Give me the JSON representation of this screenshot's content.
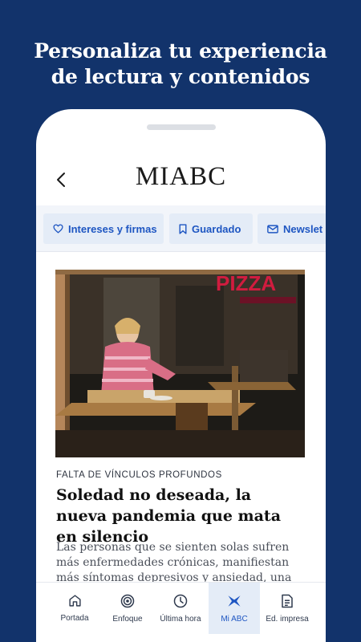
{
  "promo": {
    "title_line1": "Personaliza tu experiencia",
    "title_line2": "de lectura y contenidos"
  },
  "header": {
    "logo": "MIABC",
    "back_icon": "chevron-left-icon"
  },
  "tabs": [
    {
      "label": "Intereses y firmas",
      "icon": "heart-icon"
    },
    {
      "label": "Guardado",
      "icon": "bookmark-icon"
    },
    {
      "label": "Newslet",
      "icon": "mail-icon"
    }
  ],
  "article": {
    "kicker": "FALTA DE VÍNCULOS PROFUNDOS",
    "headline": "Soledad no deseada, la nueva pandemia que mata en silencio",
    "summary": "Las personas que se sienten solas sufren más enfermedades crónicas, manifiestan más síntomas depresivos y ansiedad, una",
    "photo_sign": "PIZZA"
  },
  "bottom_nav": [
    {
      "label": "Portada",
      "icon": "home-icon",
      "active": false
    },
    {
      "label": "Enfoque",
      "icon": "target-icon",
      "active": false
    },
    {
      "label": "Última hora",
      "icon": "clock-icon",
      "active": false
    },
    {
      "label": "Mi ABC",
      "icon": "mi-abc-icon",
      "active": true
    },
    {
      "label": "Ed. impresa",
      "icon": "newspaper-icon",
      "active": false
    }
  ],
  "colors": {
    "background": "#12336b",
    "accent": "#1e56c2",
    "tab_bg": "#e4ecf7"
  }
}
